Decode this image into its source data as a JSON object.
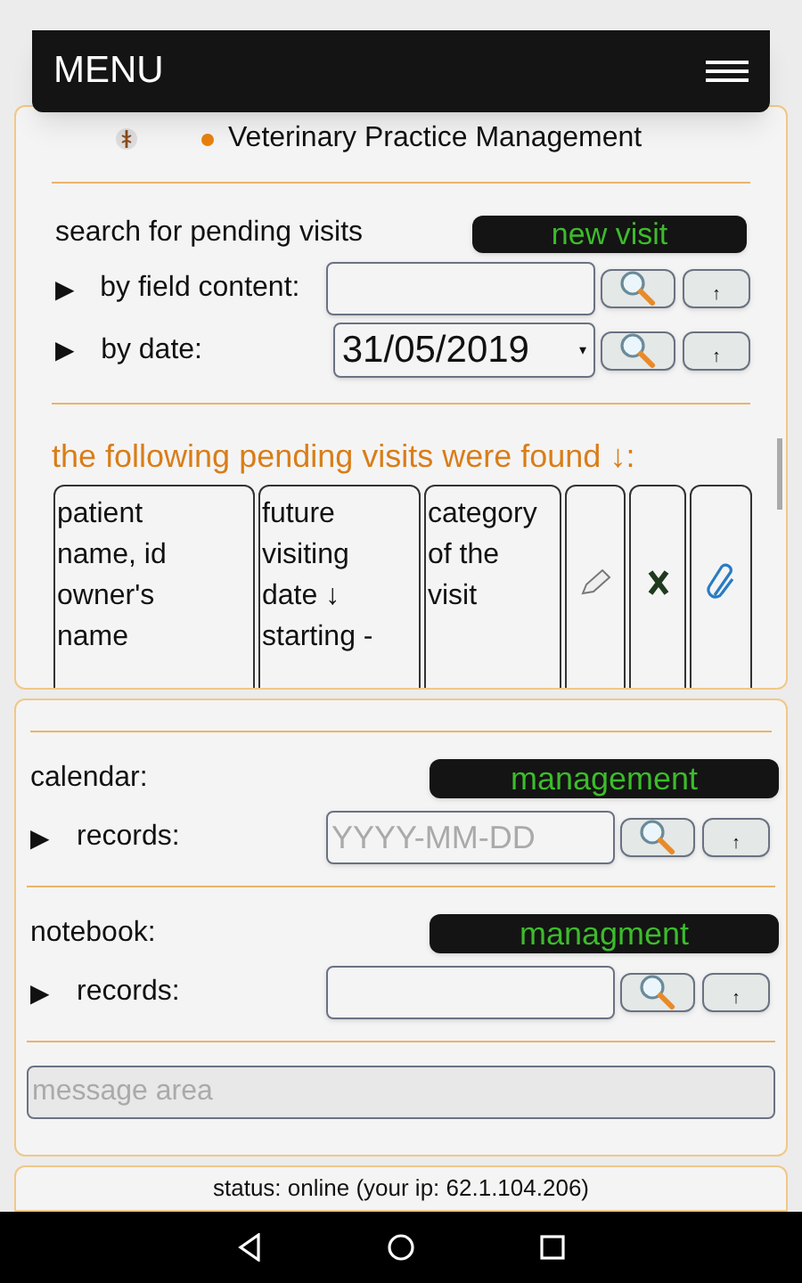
{
  "menu": {
    "title": "MENU"
  },
  "header": {
    "title": "Veterinary Practice Management"
  },
  "pending_search": {
    "label": "search for pending visits",
    "new_button": "new visit",
    "filters": [
      {
        "marker": "▶",
        "label": "by field content:",
        "kind": "text",
        "up": "↑"
      },
      {
        "marker": "▶",
        "label": "by date:",
        "kind": "date",
        "value": "31/05/2019",
        "dropdown": "▾",
        "up": "↑"
      }
    ]
  },
  "results": {
    "heading": "the following pending visits were found ↓:",
    "columns": [
      {
        "kind": "text",
        "label": "patient\nname, id\nowner's\nname"
      },
      {
        "kind": "text",
        "label": "future\nvisiting\ndate ↓\n starting -"
      },
      {
        "kind": "text",
        "label": "category\nof the\nvisit"
      },
      {
        "kind": "edit"
      },
      {
        "kind": "delete"
      },
      {
        "kind": "attach"
      }
    ]
  },
  "registers": [
    {
      "label": "calendar:",
      "button": "management",
      "marker": "▶",
      "records_label": "records:",
      "placeholder": "YYYY-MM-DD",
      "up": "↑"
    },
    {
      "label": "notebook:",
      "button": "managment",
      "marker": "▶",
      "records_label": "records:",
      "up": "↑"
    }
  ],
  "message": {
    "placeholder": "message area"
  },
  "status": "status: online (your ip: 62.1.104.206)"
}
